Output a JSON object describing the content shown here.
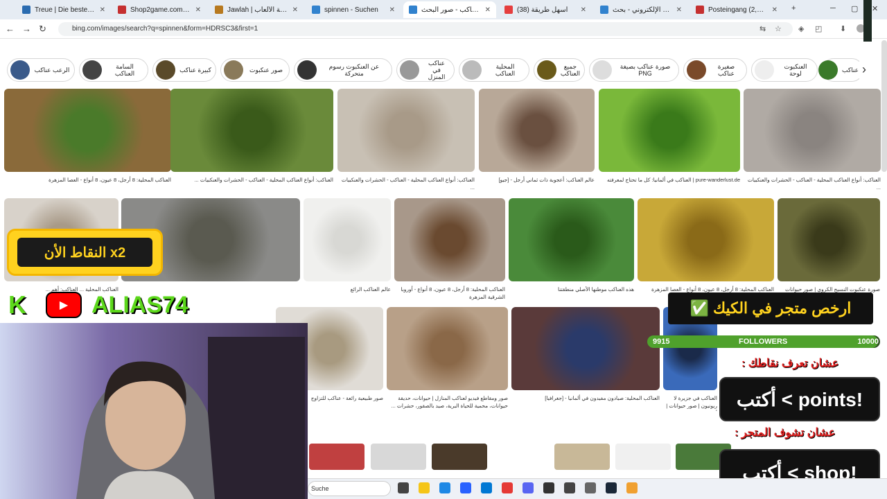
{
  "tabs": [
    {
      "title": "Treue | Die beste Software",
      "color": "#2b6cb0"
    },
    {
      "title": "Shop2game.com - أفريقيا",
      "color": "#c53030"
    },
    {
      "title": "Jawlah | جولة - منصة الألعاب",
      "color": "#b7791f"
    },
    {
      "title": "spinnen - Suchen",
      "color": "#3182ce"
    },
    {
      "title": "العناكب - صور البحث",
      "color": "#3182ce"
    },
    {
      "title": "(38) أسهل طريقة",
      "color": "#e53e3e"
    },
    {
      "title": "البريد الإلكتروني - بحث",
      "color": "#3182ce"
    },
    {
      "title": "Posteingang (2,659) - alia",
      "color": "#c53030"
    }
  ],
  "new_tab": "+",
  "address": "bing.com/images/search?q=spinnen&form=HDRSC3&first=1",
  "chips": [
    {
      "label": "الرعب عناكب",
      "color": "#3a5a8a"
    },
    {
      "label": "السامة العناكب",
      "color": "#444"
    },
    {
      "label": "كبيرة عناكب",
      "color": "#5a4a2a"
    },
    {
      "label": "صور عنكبوت",
      "color": "#8a7a5a"
    },
    {
      "label": "عن العنكبوت رسوم متحركة",
      "color": "#333"
    },
    {
      "label": "عناكب في المنزل",
      "color": "#999"
    },
    {
      "label": "المحلية العناكب",
      "color": "#bbb"
    },
    {
      "label": "جميع العناكب",
      "color": "#6a5a1a"
    },
    {
      "label": "صورة عناكب بصيغة PNG",
      "color": "#ddd"
    },
    {
      "label": "صغيرة عناكب",
      "color": "#7a4a2a"
    },
    {
      "label": "العنكبوت لوحة",
      "color": "#eee"
    },
    {
      "label": "عناكب",
      "color": "#3a7a2a"
    }
  ],
  "row1": [
    {
      "caption": "العناكب المحلية: 8 أرجل، 8 عيون، 8 أنواع - العصا المزهرة",
      "a": "#8a6a3a",
      "b": "#4a7a2a"
    },
    {
      "caption": "العناكب: أنواع العناكب المحلية - العناكب - الحشرات والعنكبيات ...",
      "a": "#6a8a3a",
      "b": "#3a5a1a"
    },
    {
      "caption": "العناكب: أنواع العناكب المحلية - العناكب - الحشرات والعنكبيات ...",
      "a": "#c8c0b4",
      "b": "#a89a88"
    },
    {
      "caption": "عالم العناكب: أعجوبة ذات ثماني أرجل - [جيو]",
      "a": "#b8a898",
      "b": "#6a5040"
    },
    {
      "caption": "pure-wanderlust.de | العناكب في ألمانيا: كل ما تحتاج لمعرفته",
      "a": "#7ab83a",
      "b": "#3a7a1a"
    },
    {
      "caption": "العناكب: أنواع العناكب المحلية - العناكب - الحشرات والعنكبيات ...",
      "a": "#b0aaa4",
      "b": "#8a8480"
    }
  ],
  "row2": [
    {
      "caption": "العناكب المحلية ... العناكب: أهم ...",
      "a": "#d8d2ca",
      "b": "#a89a88"
    },
    {
      "caption": "",
      "a": "#8a8a88",
      "b": "#5a5a50"
    },
    {
      "caption": "عالم العناكب الرائع",
      "a": "#f0f0ee",
      "b": "#d8d8d4"
    },
    {
      "caption": "العناكب المحلية: 8 أرجل، 8 عيون، 8 أنواع - أوروبا الشرقية المزهرة",
      "a": "#a8988a",
      "b": "#6a4a30"
    },
    {
      "caption": "هذه العناكب موطنها الأصلي منطقتنا",
      "a": "#4a8a3a",
      "b": "#2a5a1a"
    },
    {
      "caption": "العناكب المحلية: 8 أرجل، 8 عيون، 8 أنواع - العصا المزهرة",
      "a": "#c8a838",
      "b": "#8a6a18"
    },
    {
      "caption": "صورة عنكبوت النسيج الكروي | صور حيوانات",
      "a": "#6a6a3a",
      "b": "#3a3a1a"
    }
  ],
  "row3": [
    {
      "caption": "صور طبيعية رائعة - عناكب للتزاوج",
      "a": "#e0dcd6",
      "b": "#a89a80"
    },
    {
      "caption": "صور ومقاطع فيديو لعناكب المنازل | حيوانات، حديقة حيوانات، محمية للحياة البرية، صيد بالصقور، حشرات ...",
      "a": "#b8a088",
      "b": "#8a6848"
    },
    {
      "caption": "العناكب المحلية: صيادون مفيدون في ألمانيا - [جغرافيا]",
      "a": "#5a3a3a",
      "b": "#2a3a6a"
    },
    {
      "caption": "العناكب في جزيرة لا ريونيون | صور حيوانات | أفريقيا، عبد القصص ...",
      "a": "#3a6aba",
      "b": "#1a2a4a"
    }
  ],
  "bottom_thumbs": [
    "#c04040",
    "#d8d8d8",
    "#4a3a2a",
    "#ffffff",
    "#c8b898",
    "#f0f0f0",
    "#4a7a3a"
  ],
  "overlay": {
    "badge": "النقاط الأن x2",
    "k": "K",
    "yt": "▶",
    "alias": "ALIAS74",
    "store": "ارخص متجر في الكيك",
    "store_check": "✅",
    "followers_current": "9915",
    "followers_label": "FOLLOWERS",
    "followers_goal": "10000",
    "followers_progress": 0.9915,
    "hint_points": "عشان تعرف نقاطك :",
    "cmd_points": "أكتب < points!",
    "hint_shop": "عشان تشوف المتجر :",
    "cmd_shop": "أكتب < shop!"
  },
  "taskbar": {
    "search_label": "Suche",
    "icons": [
      "#444",
      "#f5c518",
      "#1e88e5",
      "#2962ff",
      "#0078d4",
      "#e53935",
      "#5865f2",
      "#333",
      "#444",
      "#666",
      "#1b2838",
      "#f0a030"
    ]
  }
}
